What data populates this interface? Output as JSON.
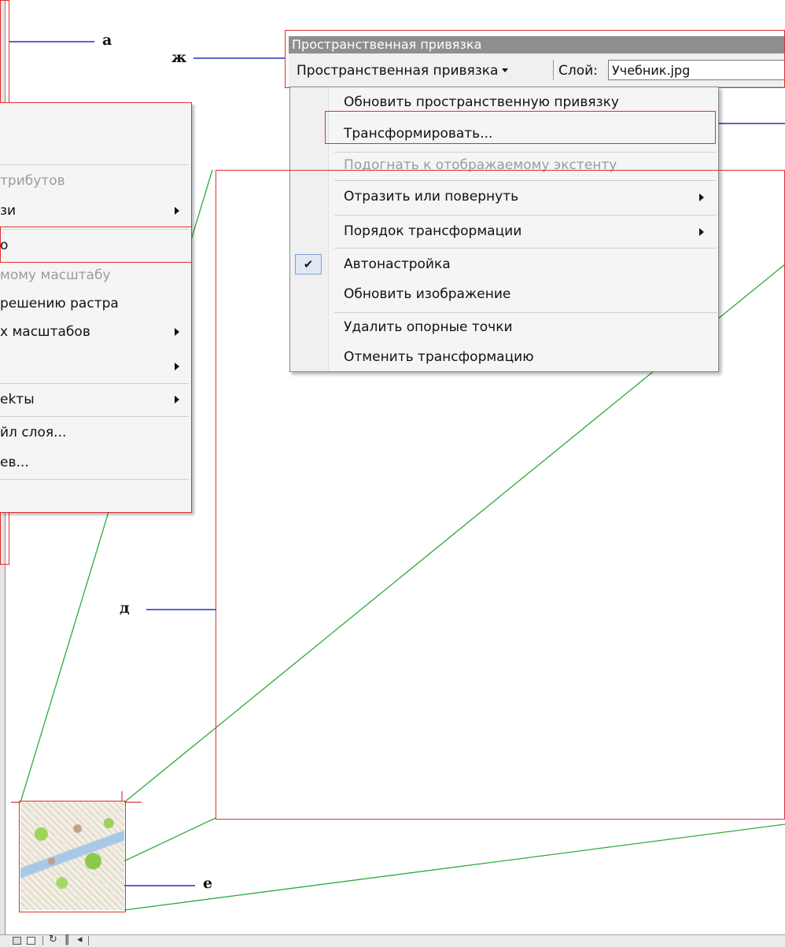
{
  "callouts": {
    "a": "а",
    "zh": "ж",
    "d": "д",
    "e": "е"
  },
  "toolbar": {
    "title": "Пространственная привязка",
    "dropdown_label": "Пространственная привязка",
    "layer_label": "Слой:",
    "layer_value": "Учебник.jpg"
  },
  "dropdown_menu": {
    "items": [
      {
        "label": "Обновить пространственную привязку"
      },
      {
        "label": "Трансформировать..."
      },
      {
        "label": "Подогнать к отображаемому экстенту"
      },
      {
        "label": "Отразить или повернуть"
      },
      {
        "label": "Порядок трансформации"
      },
      {
        "label": "Автонастройка"
      },
      {
        "label": "Обновить изображение"
      },
      {
        "label": "Удалить опорные точки"
      },
      {
        "label": "Отменить трансформацию"
      }
    ]
  },
  "context_menu": {
    "items": [
      {
        "label": "трибутов"
      },
      {
        "label": "зи"
      },
      {
        "label": "о"
      },
      {
        "label": "мому масштабу"
      },
      {
        "label": "решению растра"
      },
      {
        "label": "х масштабов"
      },
      {
        "label": "ekты"
      },
      {
        "label": "йл слоя..."
      },
      {
        "label": "ев..."
      }
    ]
  },
  "colors": {
    "highlight_red": "#e03030",
    "leader_blue": "#2233bb",
    "connector_green": "#2eaa3a"
  },
  "icons": {
    "check": "✔"
  }
}
